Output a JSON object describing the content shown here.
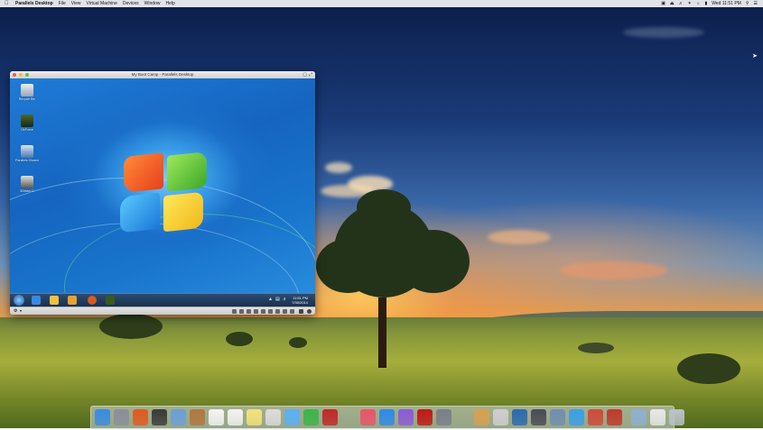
{
  "menubar": {
    "app_name": "Parallels Desktop",
    "menus": [
      "File",
      "View",
      "Virtual Machine",
      "Devices",
      "Window",
      "Help"
    ],
    "clock": "Wed 11:51 PM"
  },
  "parallels_window": {
    "title": "My Boot Camp - Parallels Desktop",
    "desktop_icons": [
      {
        "label": "Recycle Bin"
      },
      {
        "label": "GeForce"
      },
      {
        "label": "Parallels Shared"
      },
      {
        "label": "3DMark11"
      }
    ],
    "taskbar_clock_time": "11:51 PM",
    "taskbar_clock_date": "7/30/2014"
  },
  "colors": {
    "win7_taskbar": "#172e4a",
    "win7_desktop": "#1565c0",
    "menubar_bg": "#ebebee"
  },
  "dock": {
    "icons": [
      {
        "name": "finder-icon",
        "color": "#3a8be0"
      },
      {
        "name": "launchpad-icon",
        "color": "#8a8f99"
      },
      {
        "name": "firefox-icon",
        "color": "#e05a20"
      },
      {
        "name": "mission-control-icon",
        "color": "#3a3a3a"
      },
      {
        "name": "preview-icon",
        "color": "#6aa0d8"
      },
      {
        "name": "notes-book-icon",
        "color": "#b07840"
      },
      {
        "name": "calendar-icon",
        "color": "#f4f4f4"
      },
      {
        "name": "textedit-icon",
        "color": "#f2f2f2"
      },
      {
        "name": "notes-icon",
        "color": "#f5e27a"
      },
      {
        "name": "preview-photos-icon",
        "color": "#dcdcdc"
      },
      {
        "name": "messages-icon",
        "color": "#5ab0f5"
      },
      {
        "name": "facetime-icon",
        "color": "#3bb54a"
      },
      {
        "name": "photo-booth-icon",
        "color": "#c02828"
      },
      {
        "name": "photos-icon",
        "color": "#888"
      },
      {
        "name": "itunes-icon",
        "color": "#e8556a"
      },
      {
        "name": "app-store-icon",
        "color": "#2f8ae8"
      },
      {
        "name": "ibooks-icon",
        "color": "#8c5ad8"
      },
      {
        "name": "filezilla-icon",
        "color": "#c01818"
      },
      {
        "name": "system-preferences-icon",
        "color": "#7a7f88"
      },
      {
        "name": "terminal-icon",
        "color": "#222"
      },
      {
        "name": "books-icon",
        "color": "#d8a050"
      },
      {
        "name": "keyboard-icon",
        "color": "#cfcfcf"
      },
      {
        "name": "s-app-icon",
        "color": "#2a6ab0"
      },
      {
        "name": "clapper-icon",
        "color": "#4a4a55"
      },
      {
        "name": "preview-image-icon",
        "color": "#6f8fb0"
      },
      {
        "name": "mail-icon",
        "color": "#3aa0e8"
      },
      {
        "name": "photo-app-icon",
        "color": "#d04a3a"
      },
      {
        "name": "parallels-icon",
        "color": "#c0392b"
      },
      {
        "name": "folder-icon",
        "color": "#8fb0d0"
      },
      {
        "name": "document-icon",
        "color": "#e8e8e8"
      },
      {
        "name": "trash-icon",
        "color": "#bcc2c8"
      }
    ]
  }
}
